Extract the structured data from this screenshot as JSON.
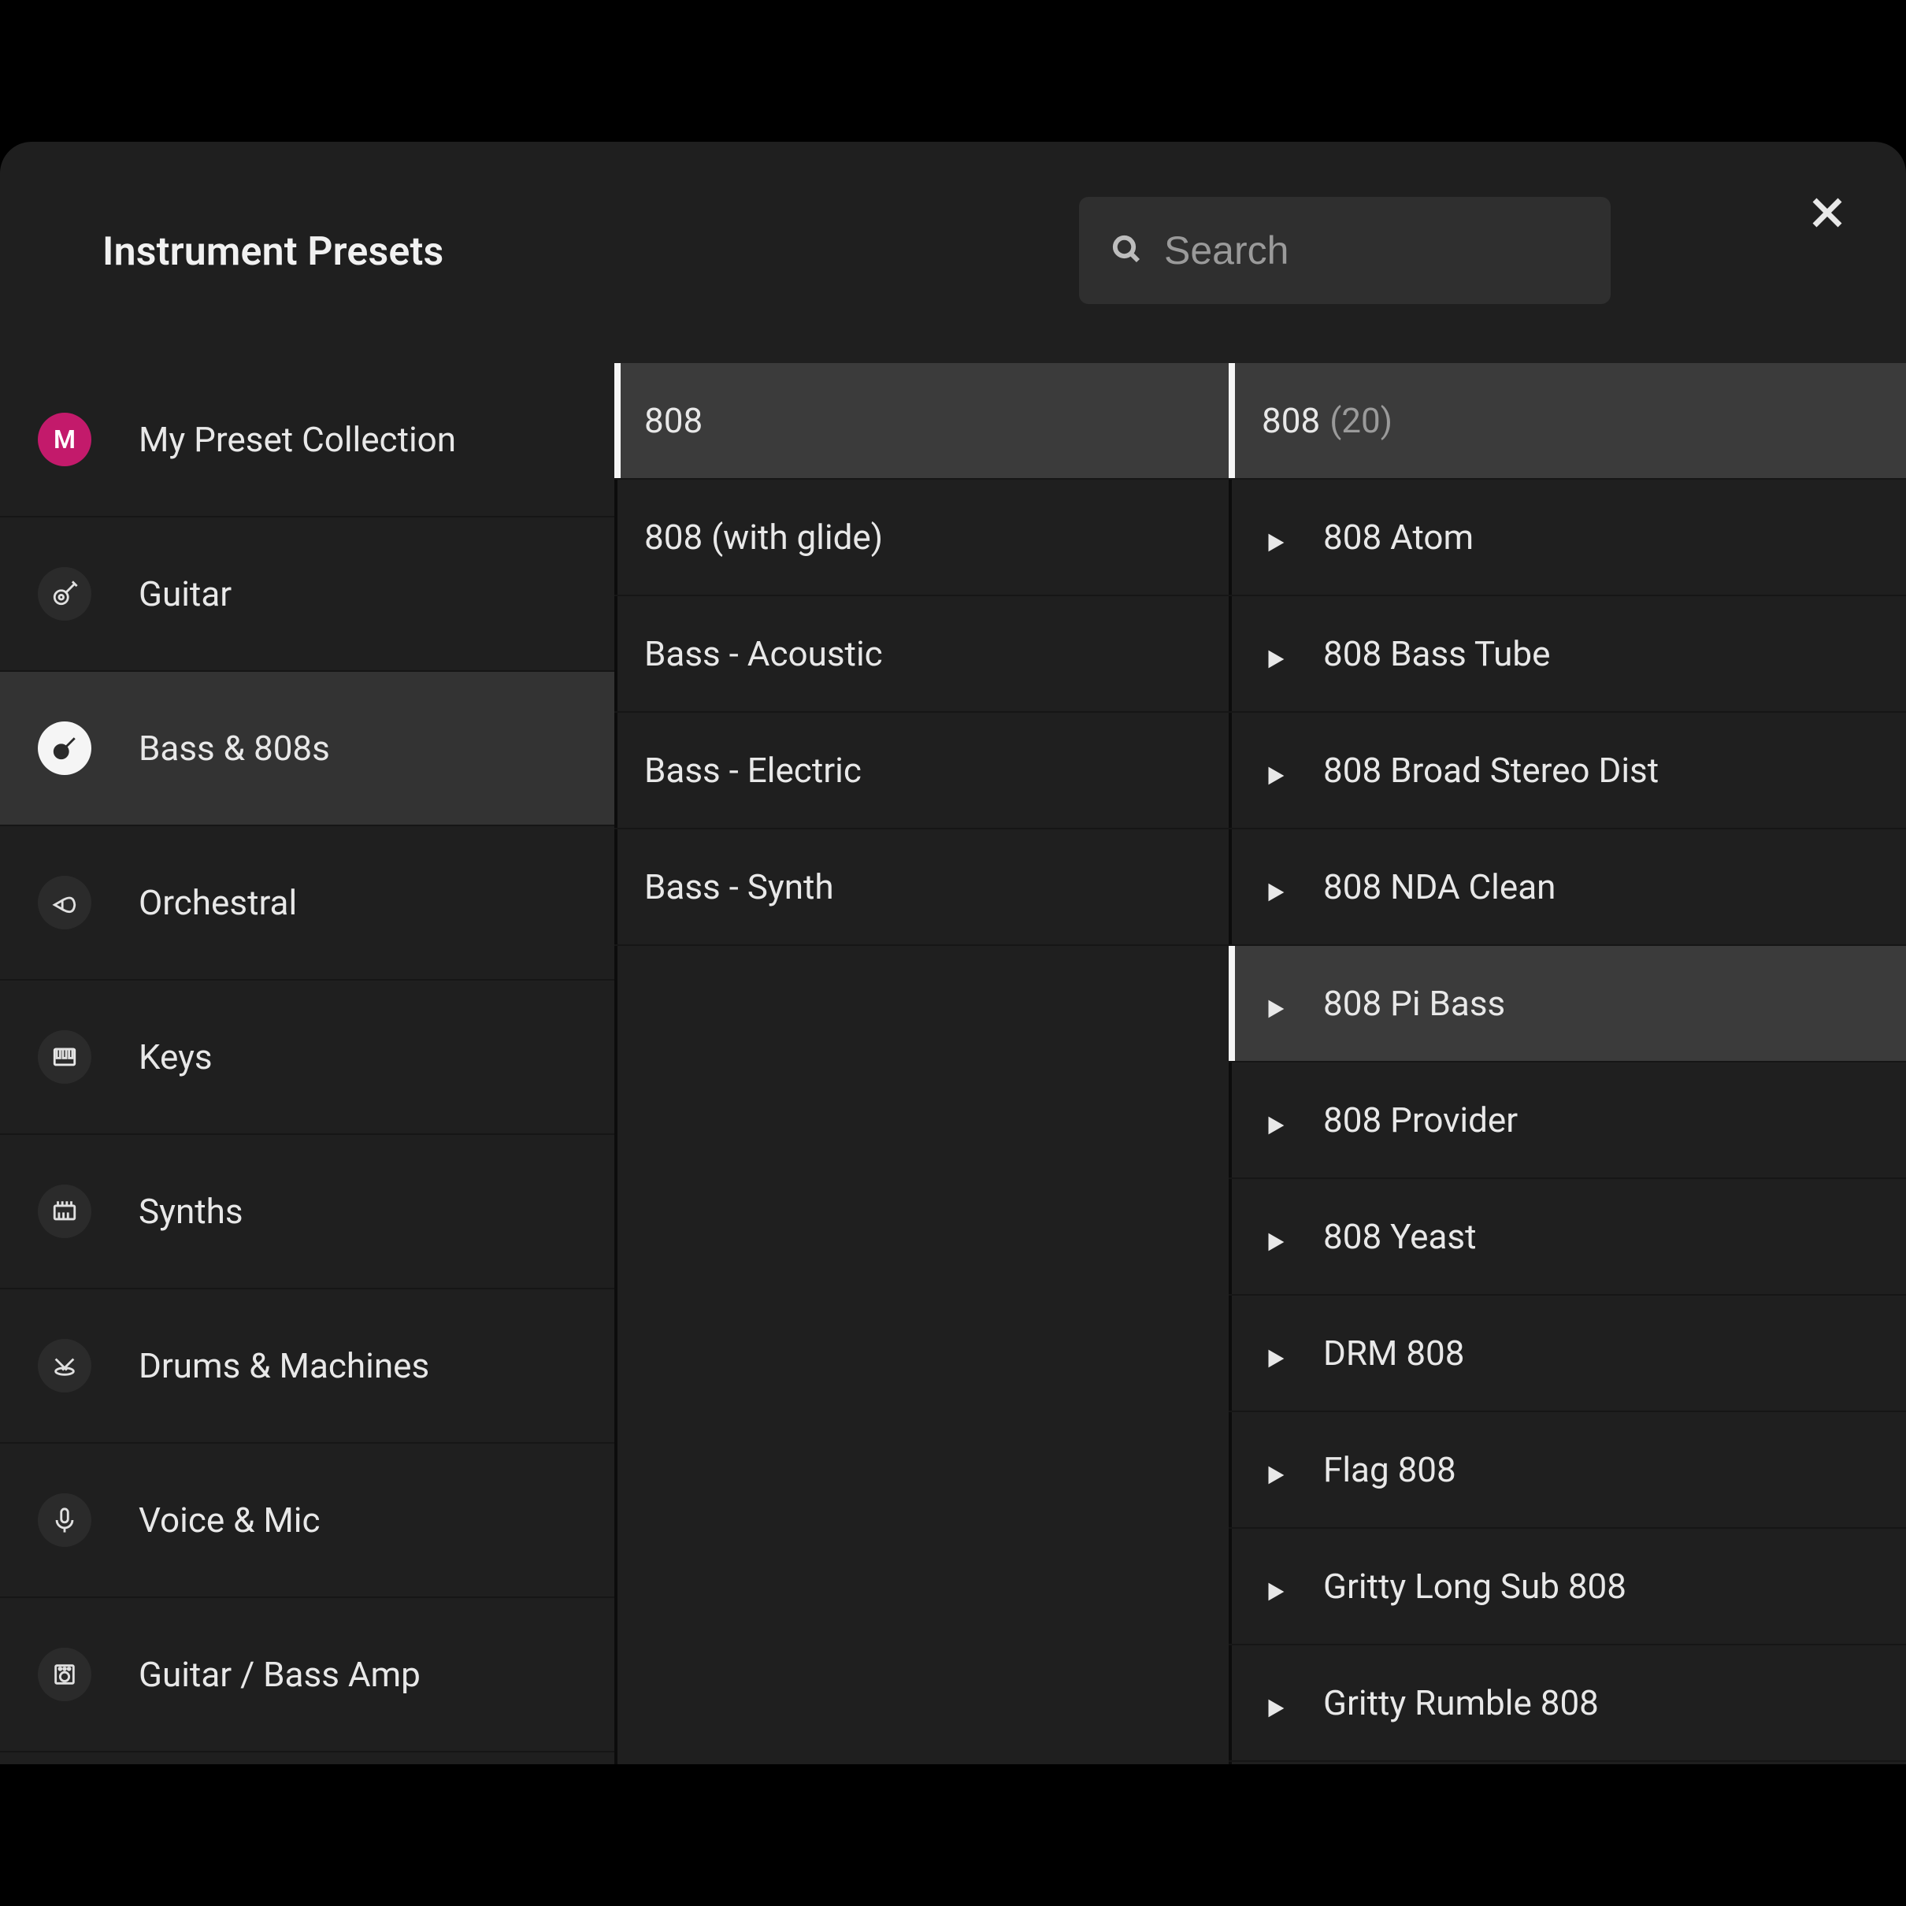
{
  "header": {
    "title": "Instrument Presets",
    "search_placeholder": "Search"
  },
  "categories": [
    {
      "label": "My Preset Collection",
      "icon": "letter-m",
      "letter": "M",
      "selected": false
    },
    {
      "label": "Guitar",
      "icon": "guitar",
      "selected": false
    },
    {
      "label": "Bass & 808s",
      "icon": "bass",
      "selected": true
    },
    {
      "label": "Orchestral",
      "icon": "horn",
      "selected": false
    },
    {
      "label": "Keys",
      "icon": "piano",
      "selected": false
    },
    {
      "label": "Synths",
      "icon": "synth",
      "selected": false
    },
    {
      "label": "Drums & Machines",
      "icon": "drums",
      "selected": false
    },
    {
      "label": "Voice & Mic",
      "icon": "mic",
      "selected": false
    },
    {
      "label": "Guitar / Bass Amp",
      "icon": "amp",
      "selected": false
    }
  ],
  "subcategories": [
    {
      "label": "808",
      "selected": true
    },
    {
      "label": "808 (with glide)",
      "selected": false
    },
    {
      "label": "Bass - Acoustic",
      "selected": false
    },
    {
      "label": "Bass - Electric",
      "selected": false
    },
    {
      "label": "Bass - Synth",
      "selected": false
    }
  ],
  "presets": {
    "title": "808",
    "count_text": "(20)",
    "items": [
      {
        "label": "808 Atom",
        "hover": false
      },
      {
        "label": "808 Bass Tube",
        "hover": false
      },
      {
        "label": "808 Broad Stereo Dist",
        "hover": false
      },
      {
        "label": "808 NDA Clean",
        "hover": false
      },
      {
        "label": "808 Pi Bass",
        "hover": true
      },
      {
        "label": "808 Provider",
        "hover": false
      },
      {
        "label": "808 Yeast",
        "hover": false
      },
      {
        "label": "DRM 808",
        "hover": false
      },
      {
        "label": "Flag 808",
        "hover": false
      },
      {
        "label": "Gritty Long Sub 808",
        "hover": false
      },
      {
        "label": "Gritty Rumble 808",
        "hover": false
      }
    ]
  }
}
